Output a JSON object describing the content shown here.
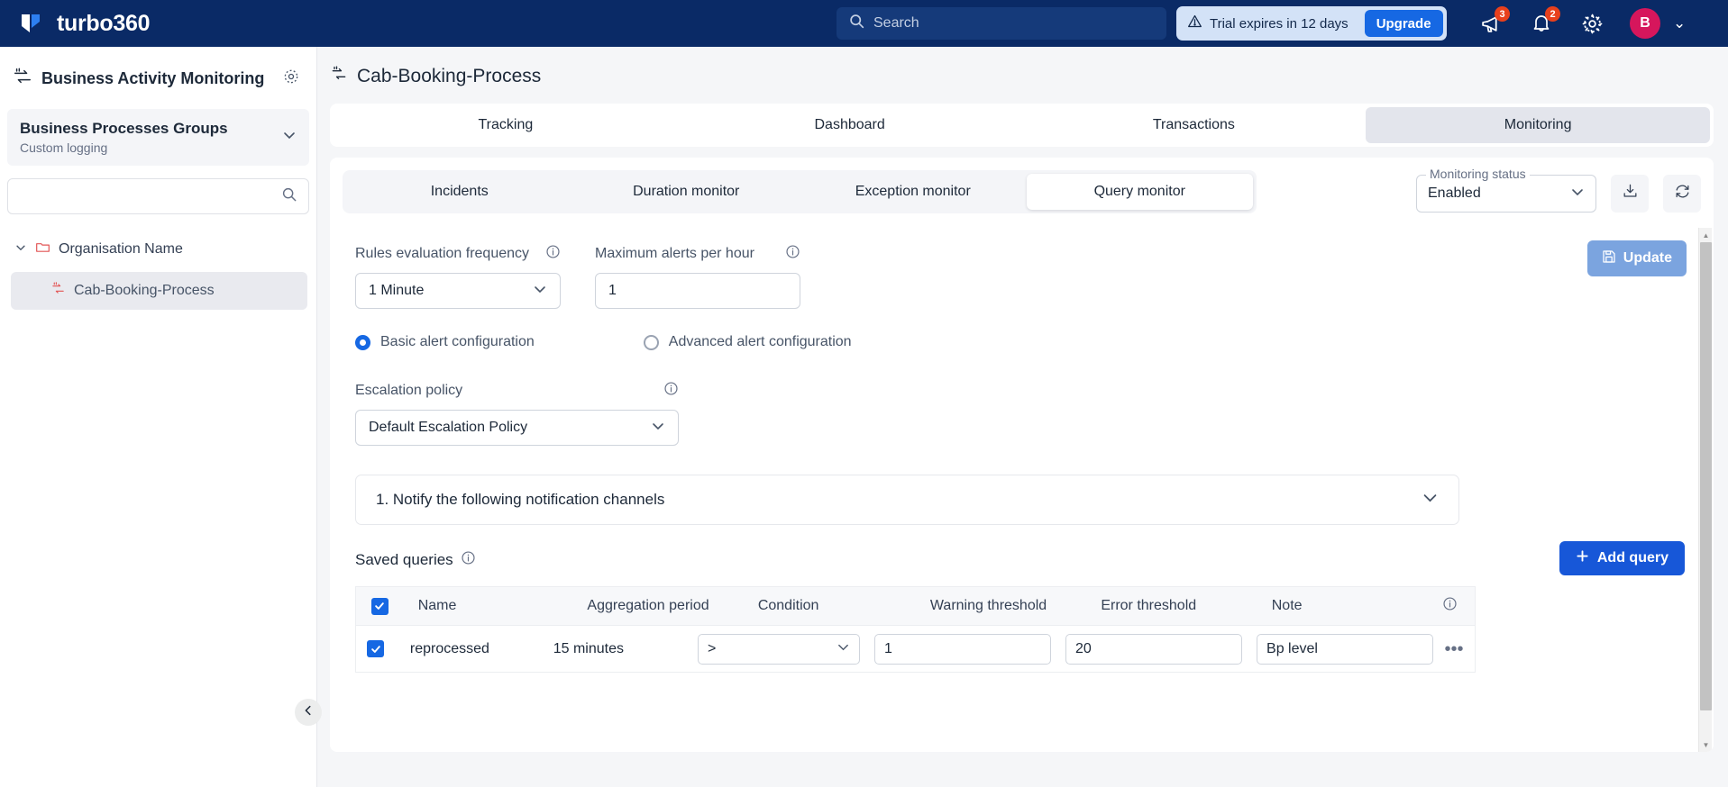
{
  "topbar": {
    "brand": "turbo360",
    "search_placeholder": "Search",
    "trial_text": "Trial expires in 12 days",
    "upgrade_label": "Upgrade",
    "announcement_badge": "3",
    "notification_badge": "2",
    "avatar_initial": "B",
    "accent": "#1668e3",
    "bar_color": "#0a2a66"
  },
  "sidebar": {
    "title": "Business Activity Monitoring",
    "group": {
      "title": "Business Processes Groups",
      "subtitle": "Custom logging"
    },
    "search_placeholder": "",
    "org_label": "Organisation Name",
    "selected_node": "Cab-Booking-Process"
  },
  "main": {
    "page_title": "Cab-Booking-Process",
    "tabs": [
      {
        "label": "Tracking",
        "active": false
      },
      {
        "label": "Dashboard",
        "active": false
      },
      {
        "label": "Transactions",
        "active": false
      },
      {
        "label": "Monitoring",
        "active": true
      }
    ],
    "subtabs": [
      {
        "label": "Incidents",
        "active": false
      },
      {
        "label": "Duration monitor",
        "active": false
      },
      {
        "label": "Exception monitor",
        "active": false
      },
      {
        "label": "Query monitor",
        "active": true
      }
    ],
    "monitoring_status": {
      "label": "Monitoring status",
      "value": "Enabled"
    },
    "update_label": "Update"
  },
  "form": {
    "rules_frequency": {
      "label": "Rules evaluation frequency",
      "value": "1 Minute"
    },
    "max_alerts": {
      "label": "Maximum alerts per hour",
      "value": "1"
    },
    "alert_mode": [
      {
        "label": "Basic alert configuration",
        "selected": true
      },
      {
        "label": "Advanced alert configuration",
        "selected": false
      }
    ],
    "escalation_policy": {
      "label": "Escalation policy",
      "value": "Default Escalation Policy"
    },
    "accordion_title": "1.  Notify the following notification channels"
  },
  "saved_queries": {
    "title": "Saved queries",
    "add_label": "Add query",
    "columns": [
      "Name",
      "Aggregation period",
      "Condition",
      "Warning threshold",
      "Error threshold",
      "Note"
    ],
    "rows": [
      {
        "checked": true,
        "name": "reprocessed",
        "aggregation_period": "15 minutes",
        "condition": ">",
        "warning_threshold": "1",
        "error_threshold": "20",
        "note": "Bp level"
      }
    ]
  }
}
